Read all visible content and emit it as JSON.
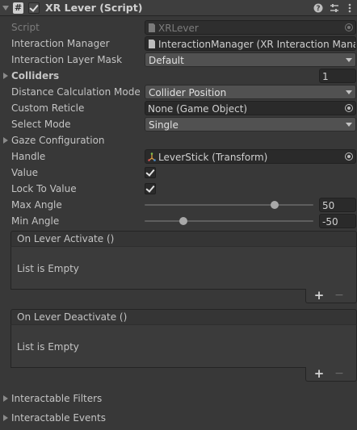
{
  "header": {
    "title": "XR Lever (Script)",
    "script_icon_glyph": "#",
    "enabled": true,
    "icons": [
      "help-icon",
      "presets-icon",
      "more-icon"
    ]
  },
  "fields": {
    "script": {
      "label": "Script",
      "value": "XRLever"
    },
    "interaction_manager": {
      "label": "Interaction Manager",
      "value": "InteractionManager (XR Interaction Mana"
    },
    "interaction_layer_mask": {
      "label": "Interaction Layer Mask",
      "value": "Default"
    },
    "colliders": {
      "label": "Colliders",
      "value": "1"
    },
    "distance_calculation_mode": {
      "label": "Distance Calculation Mode",
      "value": "Collider Position"
    },
    "custom_reticle": {
      "label": "Custom Reticle",
      "value": "None (Game Object)"
    },
    "select_mode": {
      "label": "Select Mode",
      "value": "Single"
    },
    "gaze_configuration": {
      "label": "Gaze Configuration"
    },
    "handle": {
      "label": "Handle",
      "value": "LeverStick (Transform)"
    },
    "value": {
      "label": "Value",
      "checked": true
    },
    "lock_to_value": {
      "label": "Lock To Value",
      "checked": true
    },
    "max_angle": {
      "label": "Max Angle",
      "value": "50",
      "slider_fraction": 0.77
    },
    "min_angle": {
      "label": "Min Angle",
      "value": "-50",
      "slider_fraction": 0.23
    }
  },
  "events": [
    {
      "title": "On Lever Activate ()",
      "empty_text": "List is Empty",
      "add_label": "+",
      "remove_label": "−"
    },
    {
      "title": "On Lever Deactivate ()",
      "empty_text": "List is Empty",
      "add_label": "+",
      "remove_label": "−"
    }
  ],
  "sections": {
    "interactable_filters": "Interactable Filters",
    "interactable_events": "Interactable Events"
  },
  "colors": {
    "panel": "#383838",
    "field": "#2a2a2a",
    "dropdown": "#515151",
    "text": "#c4c4c4"
  }
}
